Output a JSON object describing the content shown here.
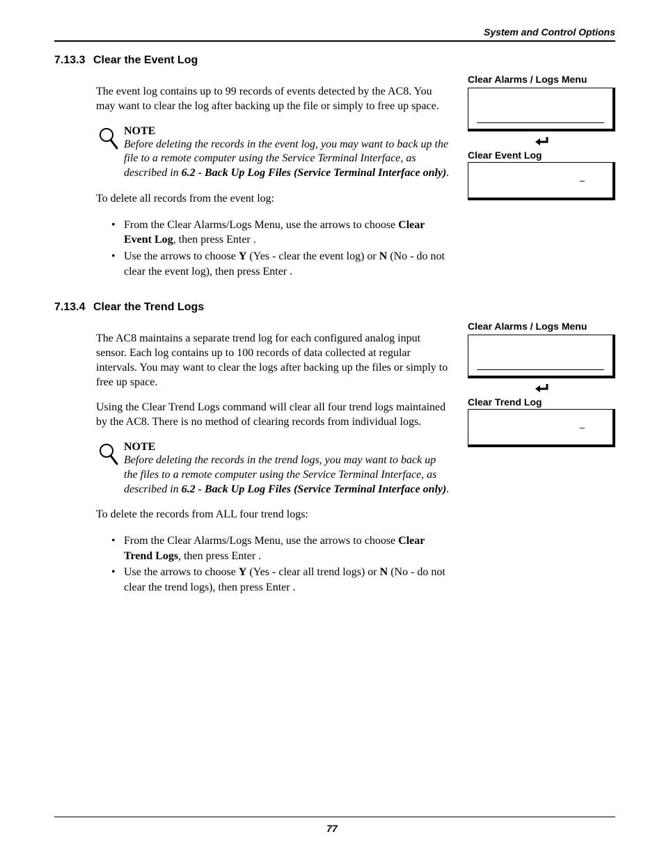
{
  "running_head": "System and Control Options",
  "page_number": "77",
  "sections": {
    "s1": {
      "num": "7.13.3",
      "title": "Clear the Event Log",
      "intro": "The event log contains up to 99 records of events detected by the AC8. You may want to clear the log after backing up the file or simply to free up space.",
      "note_label": "NOTE",
      "note_body_pre": "Before deleting the records in the event log, you may want to back up the file to a remote computer using the Service Terminal Interface, as described in ",
      "note_body_emph": "6.2 - Back Up Log Files (Service Terminal Interface only)",
      "note_body_post": ".",
      "lead": "To delete all records from the event log:",
      "step1_pre": "From the Clear Alarms/Logs Menu, use the arrows ",
      "step1_mid": " to choose ",
      "step1_bold": "Clear Event Log",
      "step1_post": ", then press Enter ",
      "step1_end": ".",
      "step2_pre": "Use the arrows ",
      "step2_mid": " to choose ",
      "step2_y": "Y",
      "step2_ytxt": " (Yes - clear the event log) or ",
      "step2_n": "N",
      "step2_ntxt": " (No - do not clear the event log), then press Enter ",
      "step2_end": ".",
      "side_title": "Clear Alarms / Logs Menu",
      "side_sub": "Clear Event Log",
      "side_dash": "–"
    },
    "s2": {
      "num": "7.13.4",
      "title": "Clear the Trend Logs",
      "intro": "The AC8 maintains a separate trend log for each configured analog input sensor. Each log contains up to 100 records of data collected at regular intervals. You may want to clear the logs after backing up the files or simply to free up space.",
      "para2": "Using the Clear Trend Logs command will clear all four trend logs maintained by the AC8. There is no method of clearing records from individual logs.",
      "note_label": "NOTE",
      "note_body_pre": "Before deleting the records in the trend logs, you may want to back up the files to a remote computer using the Service Terminal Interface, as described in ",
      "note_body_emph": "6.2 - Back Up Log Files (Service Terminal Interface only)",
      "note_body_post": ".",
      "lead": "To delete the records from ALL four trend logs:",
      "step1_pre": "From the Clear Alarms/Logs Menu, use the arrows ",
      "step1_mid": " to choose ",
      "step1_bold": "Clear Trend Logs",
      "step1_post": ", then press Enter ",
      "step1_end": ".",
      "step2_pre": "Use the arrows ",
      "step2_mid": " to choose ",
      "step2_y": "Y",
      "step2_ytxt": " (Yes - clear all trend logs) or ",
      "step2_n": "N",
      "step2_ntxt": " (No - do not clear the trend logs), then press Enter ",
      "step2_end": ".",
      "side_title": "Clear Alarms / Logs Menu",
      "side_sub": "Clear Trend Log",
      "side_dash": "–"
    }
  }
}
